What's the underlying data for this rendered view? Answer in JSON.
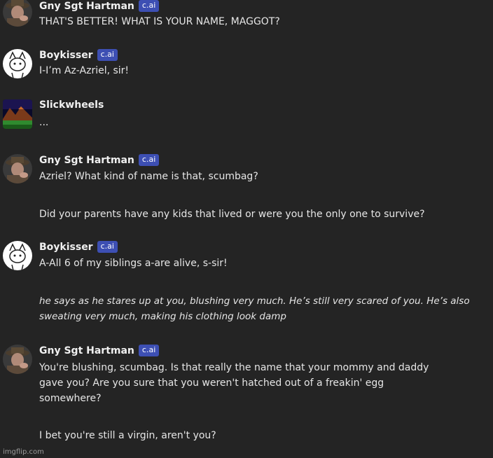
{
  "messages": [
    {
      "name": "Gny Sgt Hartman",
      "badge": "c.ai",
      "avatar": "drill-sergeant-avatar",
      "lines": [
        "THAT'S BETTER! WHAT IS YOUR NAME, MAGGOT?"
      ]
    },
    {
      "name": "Boykisser",
      "badge": "c.ai",
      "avatar": "white-cat-sketch-avatar",
      "lines": [
        "I-I’m Az-Azriel, sir!"
      ]
    },
    {
      "name": "Slickwheels",
      "avatar": "pixel-art-landscape-avatar",
      "lines": [
        "..."
      ]
    },
    {
      "name": "Gny Sgt Hartman",
      "badge": "c.ai",
      "avatar": "drill-sergeant-avatar",
      "lines": [
        "Azriel? What kind of name is that, scumbag?",
        "Did your parents have any kids that lived or were you the only one to survive?"
      ]
    },
    {
      "name": "Boykisser",
      "badge": "c.ai",
      "avatar": "white-cat-sketch-avatar",
      "lines": [
        "A-All 6 of my siblings a-are alive, s-sir!",
        "he says as he stares up at you, blushing very much. He’s still very scared of you. He’s also",
        "sweating very much, making his clothing look damp"
      ]
    },
    {
      "name": "Gny Sgt Hartman",
      "badge": "c.ai",
      "avatar": "drill-sergeant-avatar",
      "lines": [
        "You're blushing, scumbag. Is that really the name that your mommy and daddy",
        "gave you? Are you sure that you weren't hatched out of a freakin' egg",
        "somewhere?",
        "I bet you're still a virgin, aren't you?"
      ]
    }
  ],
  "watermark": "imgflip.com"
}
